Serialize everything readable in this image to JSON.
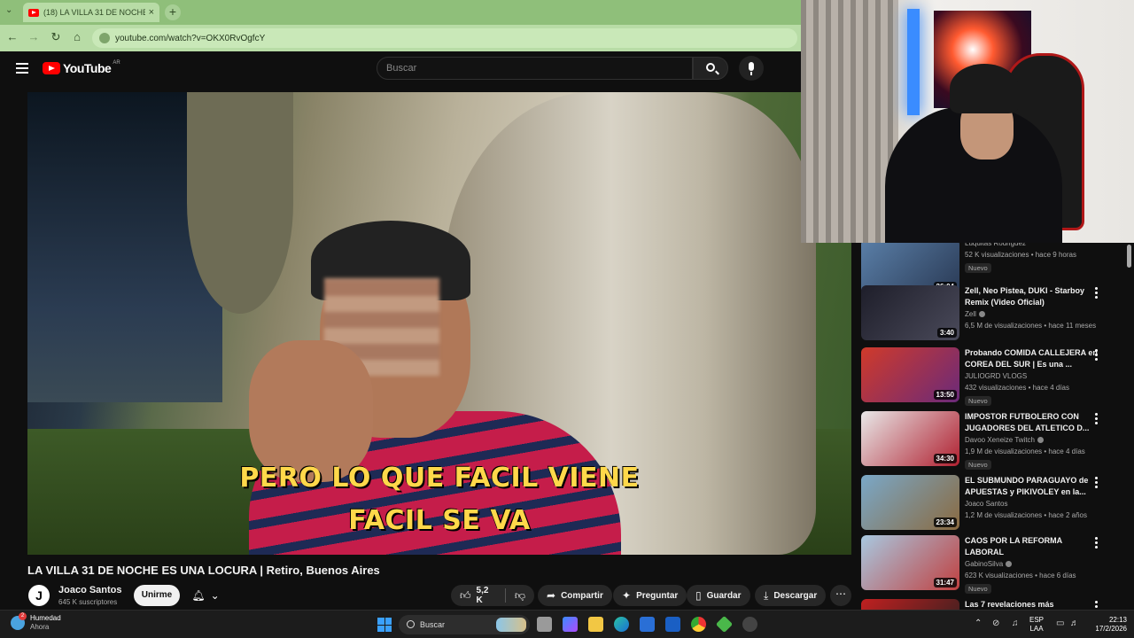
{
  "browser": {
    "tab_title": "(18) LA VILLA 31 DE NOCHE ES",
    "url": "youtube.com/watch?v=OKX0RvOgfcY"
  },
  "youtube": {
    "logo": "YouTube",
    "country": "AR",
    "search_placeholder": "Buscar"
  },
  "video": {
    "subtitle_line1": "PERO LO QUE FACIL VIENE",
    "subtitle_line2": "FACIL SE VA",
    "title": "LA VILLA 31 DE NOCHE ES UNA LOCURA | Retiro, Buenos Aires",
    "channel": "Joaco Santos",
    "channel_initial": "J",
    "subscribers": "645 K suscriptores",
    "join_label": "Unirme",
    "likes": "5,2 K",
    "share_label": "Compartir",
    "ask_label": "Preguntar",
    "save_label": "Guardar",
    "download_label": "Descargar"
  },
  "recommendations": [
    {
      "title": "",
      "channel": "Luquitas Rodriguez",
      "meta": "52 K visualizaciones • hace 9 horas",
      "badge": "Nuevo",
      "duration": "26:04",
      "verified": false,
      "colors": [
        "#5a7fa8",
        "#2a3a55"
      ]
    },
    {
      "title": "Zell, Neo Pistea, DUKI - Starboy Remix (Video Oficial)",
      "channel": "Zell",
      "meta": "6,5 M de visualizaciones • hace 11 meses",
      "badge": "",
      "duration": "3:40",
      "verified": true,
      "colors": [
        "#1e1e2a",
        "#4a4a5a"
      ]
    },
    {
      "title": "Probando COMIDA CALLEJERA en COREA DEL SUR | Es una ...",
      "channel": "JULIOGRD VLOGS",
      "meta": "432 visualizaciones • hace 4 días",
      "badge": "Nuevo",
      "duration": "13:50",
      "verified": false,
      "colors": [
        "#d03a2a",
        "#6a2a7a"
      ]
    },
    {
      "title": "IMPOSTOR FUTBOLERO CON JUGADORES DEL ATLETICO D...",
      "channel": "Davoo Xeneize Twitch",
      "meta": "1,9 M de visualizaciones • hace 4 días",
      "badge": "Nuevo",
      "duration": "34:30",
      "verified": true,
      "colors": [
        "#e8e8e8",
        "#b02030"
      ]
    },
    {
      "title": "EL SUBMUNDO PARAGUAYO de APUESTAS y PIKIVOLEY en la...",
      "channel": "Joaco Santos",
      "meta": "1,2 M de visualizaciones • hace 2 años",
      "badge": "",
      "duration": "23:34",
      "verified": false,
      "colors": [
        "#7aa8c8",
        "#8a6a40"
      ]
    },
    {
      "title": "CAOS POR LA REFORMA LABORAL",
      "channel": "GabinoSilva",
      "meta": "623 K visualizaciones • hace 6 días",
      "badge": "Nuevo",
      "duration": "31:47",
      "verified": true,
      "colors": [
        "#a8c8e0",
        "#c04040"
      ]
    },
    {
      "title": "Las 7 revelaciones más",
      "channel": "",
      "meta": "",
      "badge": "",
      "duration": "",
      "verified": false,
      "colors": [
        "#c02020",
        "#202020"
      ]
    }
  ],
  "taskbar": {
    "weather_title": "Humedad",
    "weather_sub": "Ahora",
    "search_label": "Buscar",
    "lang_top": "ESP",
    "lang_bottom": "LAA",
    "time": "22:13",
    "date": "17/2/2026"
  }
}
